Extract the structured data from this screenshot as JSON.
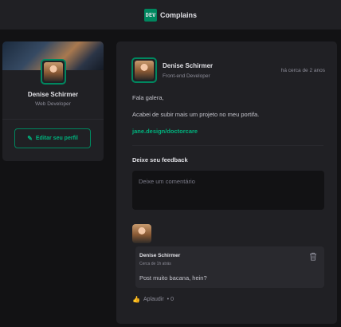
{
  "header": {
    "logo_text": "DEV",
    "brand": "Complains"
  },
  "sidebar": {
    "name": "Denise Schirmer",
    "role": "Web Developer",
    "edit_button": "Editar seu perfil"
  },
  "post": {
    "author_name": "Denise Schirmer",
    "author_role": "Front-end Developer",
    "time": "há cerca de 2 anos",
    "paragraphs": [
      "Fala galera,",
      "Acabei de subir mais um projeto no meu portifa."
    ],
    "link": "jane.design/doctorcare",
    "feedback_title": "Deixe seu feedback",
    "comment_placeholder": "Deixe um comentário"
  },
  "comment": {
    "author": "Denise Schirmer",
    "time": "Cerca de 1h atrás",
    "text": "Post muito bacana, hein?",
    "applaud_label": "Aplaudir",
    "applaud_count": "0"
  },
  "colors": {
    "accent": "#00875f",
    "accent_light": "#00b37e",
    "background": "#121214",
    "panel": "#202024"
  }
}
